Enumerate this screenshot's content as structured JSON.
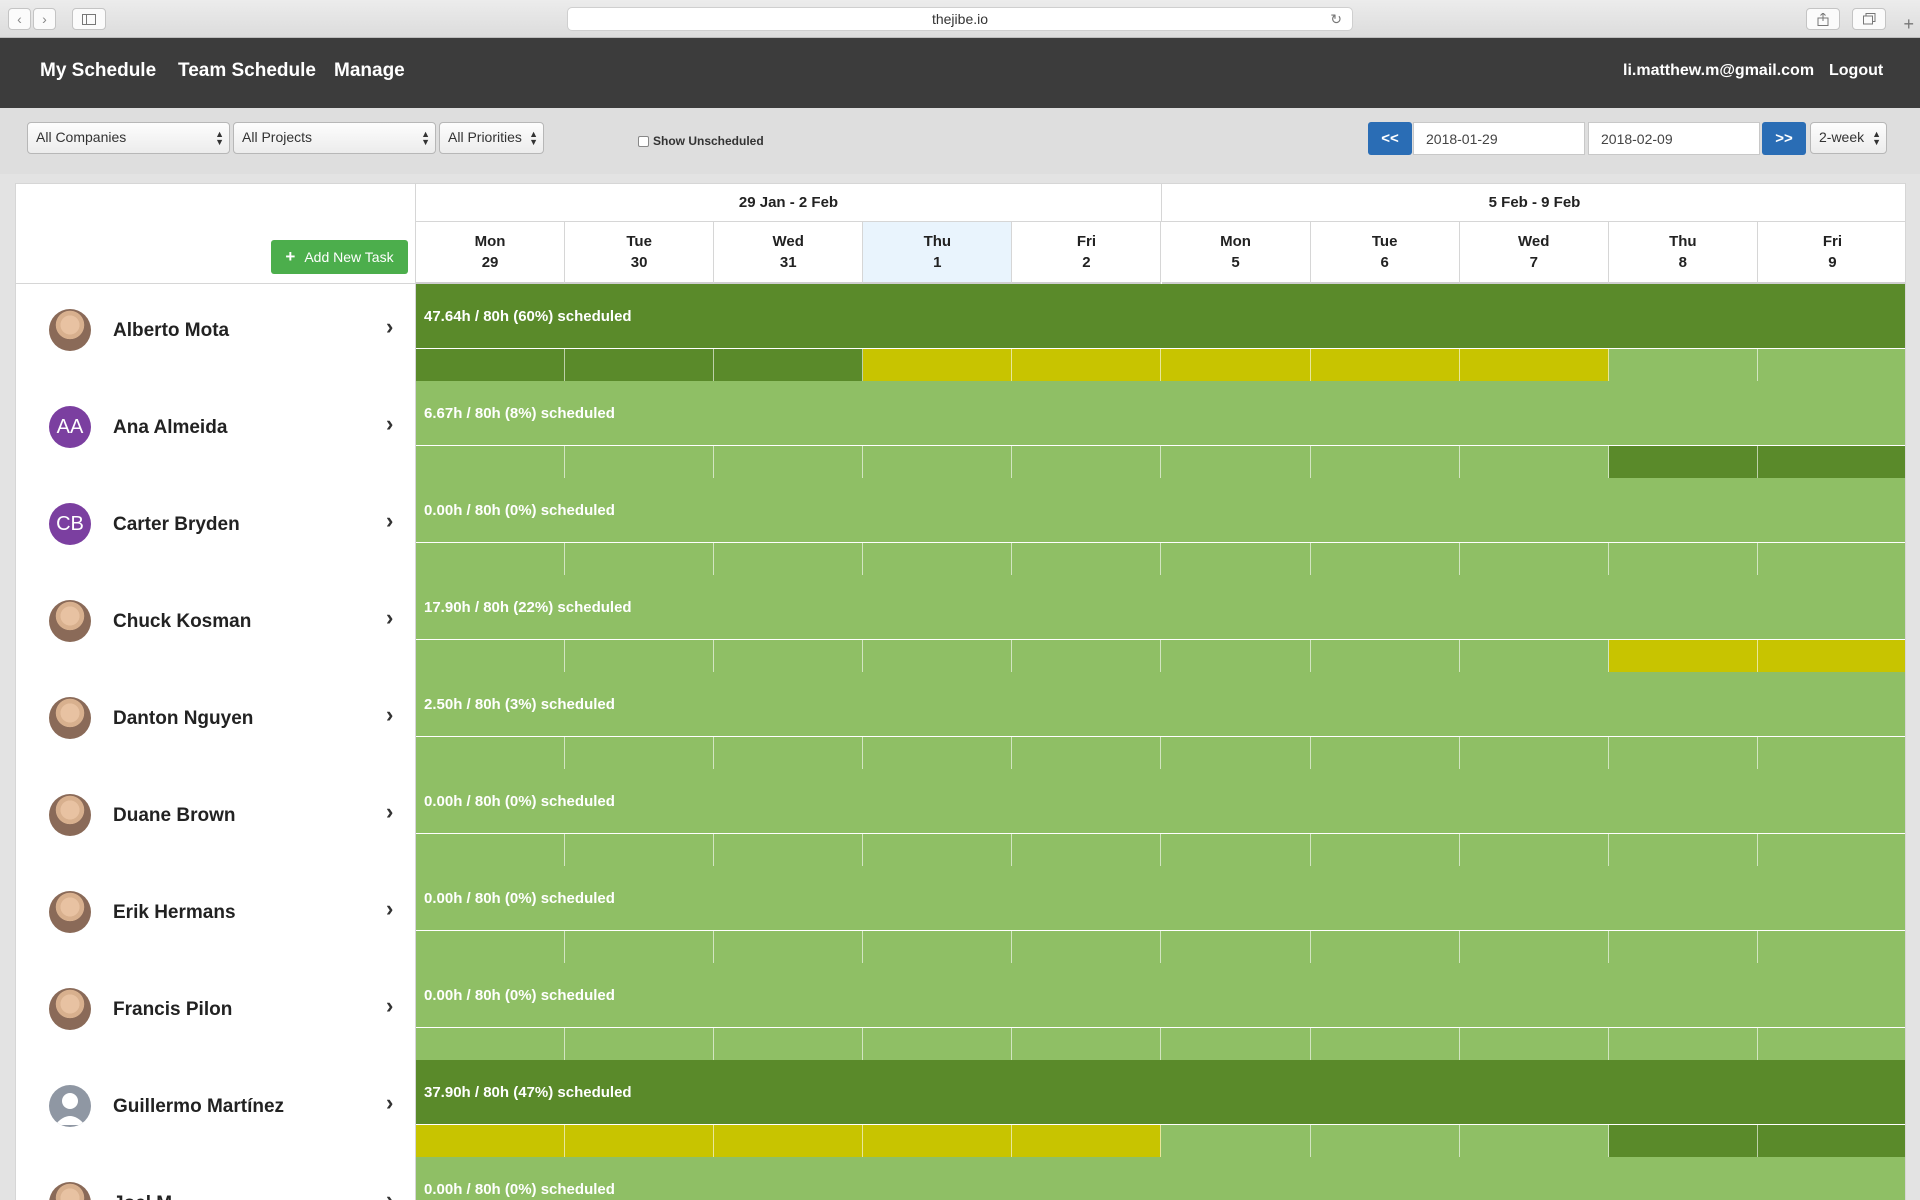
{
  "browser": {
    "url": "thejibe.io",
    "back": "‹",
    "forward": "›"
  },
  "nav": {
    "my_schedule": "My Schedule",
    "team_schedule": "Team Schedule",
    "manage": "Manage",
    "email": "li.matthew.m@gmail.com",
    "logout": "Logout"
  },
  "filters": {
    "companies": "All Companies",
    "projects": "All Projects",
    "priorities": "All Priorities",
    "show_unscheduled": "Show Unscheduled",
    "prev": "<<",
    "next": ">>",
    "start_date": "2018-01-29",
    "end_date": "2018-02-09",
    "range": "2-week"
  },
  "schedule": {
    "add_task": "Add New Task",
    "weeks": [
      "29 Jan - 2 Feb",
      "5 Feb - 9 Feb"
    ],
    "days": [
      {
        "name": "Mon",
        "num": "29"
      },
      {
        "name": "Tue",
        "num": "30"
      },
      {
        "name": "Wed",
        "num": "31"
      },
      {
        "name": "Thu",
        "num": "1",
        "today": true
      },
      {
        "name": "Fri",
        "num": "2"
      },
      {
        "name": "Mon",
        "num": "5"
      },
      {
        "name": "Tue",
        "num": "6"
      },
      {
        "name": "Wed",
        "num": "7"
      },
      {
        "name": "Thu",
        "num": "8"
      },
      {
        "name": "Fri",
        "num": "9"
      }
    ],
    "colors": {
      "light": "#8fbf65",
      "dark": "#5a8a2a",
      "yellow": "#c8c400"
    },
    "people": [
      {
        "name": "Alberto Mota",
        "avatar": "photo",
        "summary": "47.64h / 80h (60%) scheduled",
        "bar": "dark",
        "cells": [
          "dark",
          "dark",
          "dark",
          "yellow",
          "yellow",
          "yellow",
          "yellow",
          "yellow",
          "light",
          "light"
        ]
      },
      {
        "name": "Ana Almeida",
        "avatar": "initials",
        "initials": "AA",
        "summary": "6.67h / 80h (8%) scheduled",
        "bar": "light",
        "cells": [
          "light",
          "light",
          "light",
          "light",
          "light",
          "light",
          "light",
          "light",
          "dark",
          "dark"
        ]
      },
      {
        "name": "Carter Bryden",
        "avatar": "initials",
        "initials": "CB",
        "summary": "0.00h / 80h (0%) scheduled",
        "bar": "light",
        "cells": [
          "light",
          "light",
          "light",
          "light",
          "light",
          "light",
          "light",
          "light",
          "light",
          "light"
        ]
      },
      {
        "name": "Chuck Kosman",
        "avatar": "photo",
        "summary": "17.90h / 80h (22%) scheduled",
        "bar": "light",
        "cells": [
          "light",
          "light",
          "light",
          "light",
          "light",
          "light",
          "light",
          "light",
          "yellow",
          "yellow"
        ]
      },
      {
        "name": "Danton Nguyen",
        "avatar": "photo",
        "summary": "2.50h / 80h (3%) scheduled",
        "bar": "light",
        "cells": [
          "light",
          "light",
          "light",
          "light",
          "light",
          "light",
          "light",
          "light",
          "light",
          "light"
        ]
      },
      {
        "name": "Duane Brown",
        "avatar": "photo",
        "summary": "0.00h / 80h (0%) scheduled",
        "bar": "light",
        "cells": [
          "light",
          "light",
          "light",
          "light",
          "light",
          "light",
          "light",
          "light",
          "light",
          "light"
        ]
      },
      {
        "name": "Erik Hermans",
        "avatar": "photo",
        "summary": "0.00h / 80h (0%) scheduled",
        "bar": "light",
        "cells": [
          "light",
          "light",
          "light",
          "light",
          "light",
          "light",
          "light",
          "light",
          "light",
          "light"
        ]
      },
      {
        "name": "Francis Pilon",
        "avatar": "photo",
        "summary": "0.00h / 80h (0%) scheduled",
        "bar": "light",
        "cells": [
          "light",
          "light",
          "light",
          "light",
          "light",
          "light",
          "light",
          "light",
          "light",
          "light"
        ]
      },
      {
        "name": "Guillermo Martínez",
        "avatar": "generic",
        "summary": "37.90h / 80h (47%) scheduled",
        "bar": "dark",
        "cells": [
          "yellow",
          "yellow",
          "yellow",
          "yellow",
          "yellow",
          "light",
          "light",
          "light",
          "dark",
          "dark"
        ]
      },
      {
        "name": "Joel M...",
        "avatar": "photo",
        "summary": "0.00h / 80h (0%) scheduled",
        "bar": "light",
        "cells": [
          "light",
          "light",
          "light",
          "light",
          "light",
          "light",
          "light",
          "light",
          "light",
          "light"
        ]
      }
    ]
  }
}
